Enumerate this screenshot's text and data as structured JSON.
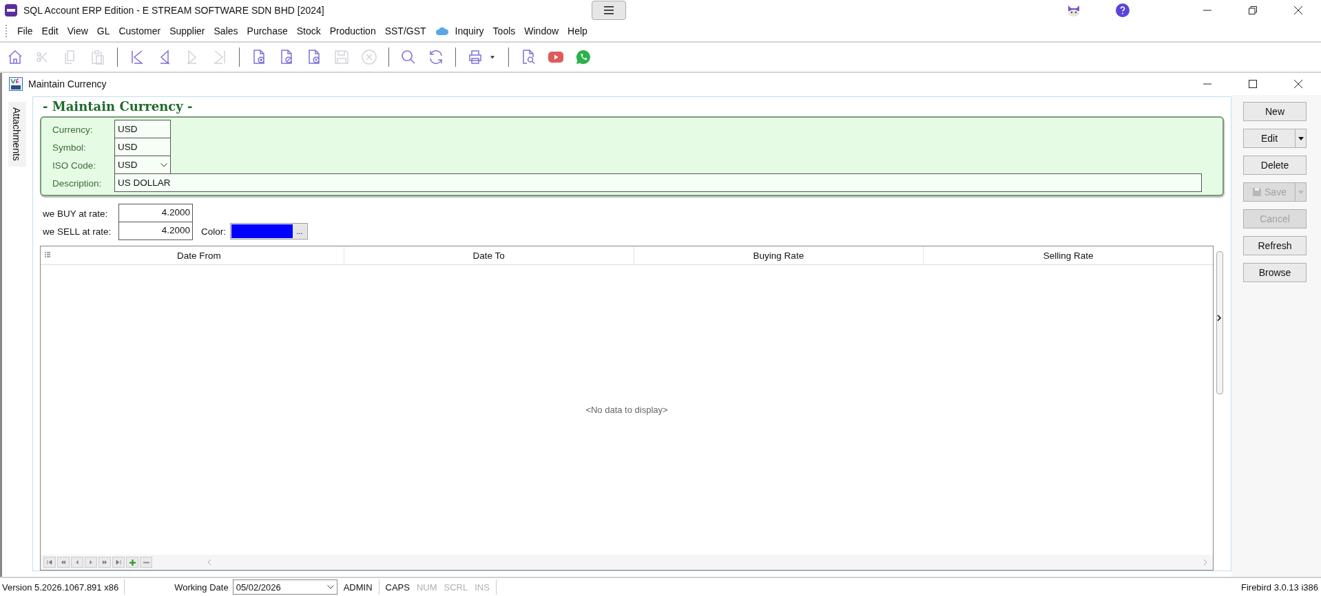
{
  "window": {
    "title": "SQL Account ERP Edition - E STREAM SOFTWARE SDN BHD [2024]"
  },
  "menu": [
    "File",
    "Edit",
    "View",
    "GL",
    "Customer",
    "Supplier",
    "Sales",
    "Purchase",
    "Stock",
    "Production",
    "SST/GST",
    "Inquiry",
    "Tools",
    "Window",
    "Help"
  ],
  "toolbar": [
    {
      "disabled": false
    },
    {
      "disabled": true
    },
    {
      "disabled": true
    },
    {
      "disabled": true
    },
    {
      "disabled": false
    },
    {
      "disabled": false
    },
    {
      "disabled": true
    },
    {
      "disabled": true
    },
    {
      "disabled": false
    },
    {
      "disabled": false
    },
    {
      "disabled": false
    },
    {
      "disabled": true
    },
    {
      "disabled": true
    },
    {
      "disabled": false
    },
    {
      "disabled": false
    },
    {
      "disabled": false
    },
    {
      "disabled": false
    },
    {
      "disabled": false
    },
    {
      "disabled": false
    },
    {
      "disabled": false
    }
  ],
  "child_window": {
    "title": "Maintain Currency"
  },
  "side_tab": "Attachments",
  "form": {
    "heading": "- Maintain Currency -",
    "fields": [
      {
        "label": "Currency:",
        "value": "USD",
        "kind": "text"
      },
      {
        "label": "Symbol:",
        "value": "USD",
        "kind": "text"
      },
      {
        "label": "ISO Code:",
        "value": "USD",
        "kind": "dropdown"
      },
      {
        "label": "Description:",
        "value": "US DOLLAR",
        "kind": "wide"
      }
    ],
    "buy_label": "we  BUY at rate:",
    "buy_rate": "4.2000",
    "sell_label": "we SELL at rate:",
    "sell_rate": "4.2000",
    "color_label": "Color:",
    "color": "#0000ff",
    "color_button": "..."
  },
  "table": {
    "columns": [
      "Date From",
      "Date To",
      "Buying Rate",
      "Selling Rate"
    ],
    "empty_text": "<No data to display>"
  },
  "buttons": [
    {
      "label": "New",
      "disabled": false,
      "split": false
    },
    {
      "label": "Edit",
      "disabled": false,
      "split": true
    },
    {
      "label": "Delete",
      "disabled": false,
      "split": false
    },
    {
      "label": "Save",
      "disabled": true,
      "split": true
    },
    {
      "label": "Cancel",
      "disabled": true,
      "split": false
    },
    {
      "label": "Refresh",
      "disabled": false,
      "split": false
    },
    {
      "label": "Browse",
      "disabled": false,
      "split": false
    }
  ],
  "status_bar": {
    "version": "Version 5.2026.1067.891 x86",
    "date_label": "Working Date",
    "date": "05/02/2026",
    "user": "ADMIN",
    "indicators": [
      {
        "label": "CAPS",
        "on": true
      },
      {
        "label": "NUM",
        "on": false
      },
      {
        "label": "SCRL",
        "on": false
      },
      {
        "label": "INS",
        "on": false
      }
    ],
    "database": "Firebird 3.0.13 i386"
  }
}
